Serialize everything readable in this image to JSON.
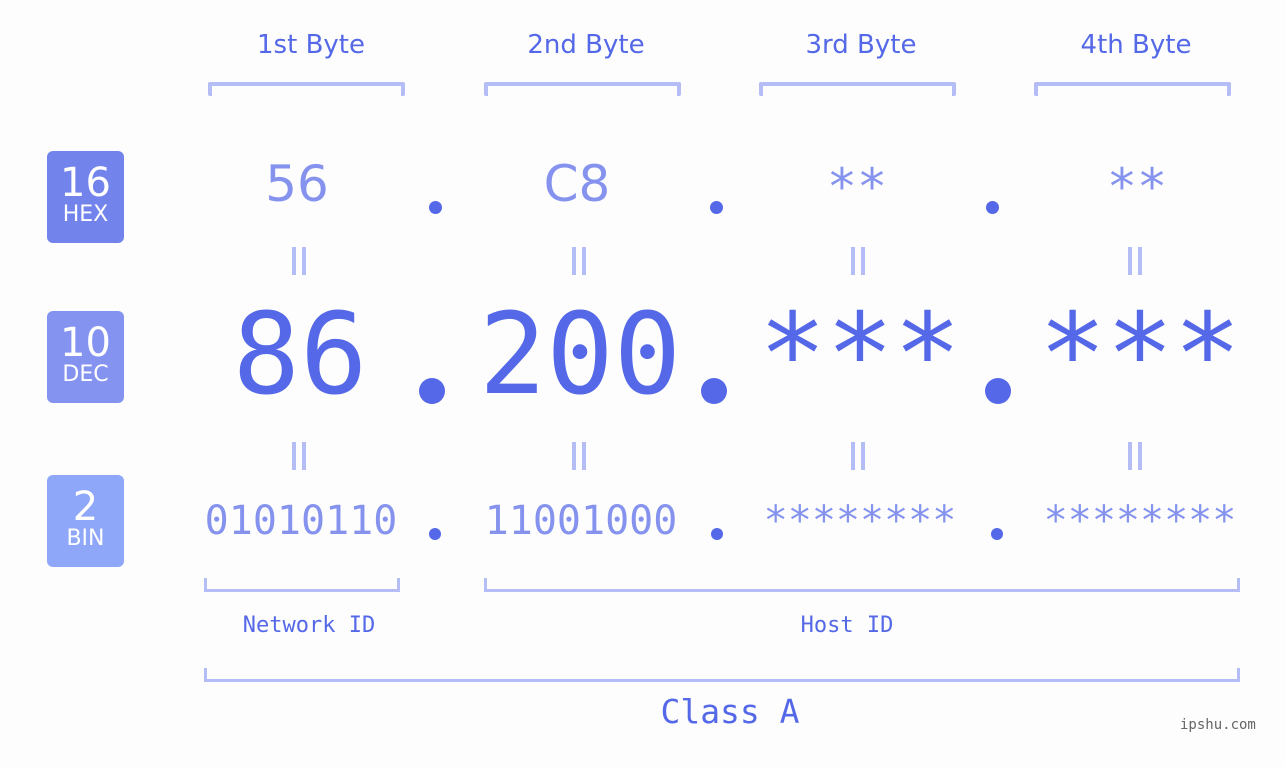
{
  "byte_headers": [
    "1st Byte",
    "2nd Byte",
    "3rd Byte",
    "4th Byte"
  ],
  "badges": {
    "hex": {
      "num": "16",
      "label": "HEX",
      "color": "#7383ec"
    },
    "dec": {
      "num": "10",
      "label": "DEC",
      "color": "#8493f0"
    },
    "bin": {
      "num": "2",
      "label": "BIN",
      "color": "#8fa7f8"
    }
  },
  "hex": [
    "56",
    "C8",
    "**",
    "**"
  ],
  "dec": [
    "86",
    "200",
    "***",
    "***"
  ],
  "bin": [
    "01010110",
    "11001000",
    "********",
    "********"
  ],
  "separator": ".",
  "network_id_label": "Network ID",
  "host_id_label": "Host ID",
  "class_label": "Class A",
  "watermark": "ipshu.com",
  "colors": {
    "primary": "#5468e8",
    "light": "#8593ee",
    "bracket": "#b4bdf6"
  }
}
